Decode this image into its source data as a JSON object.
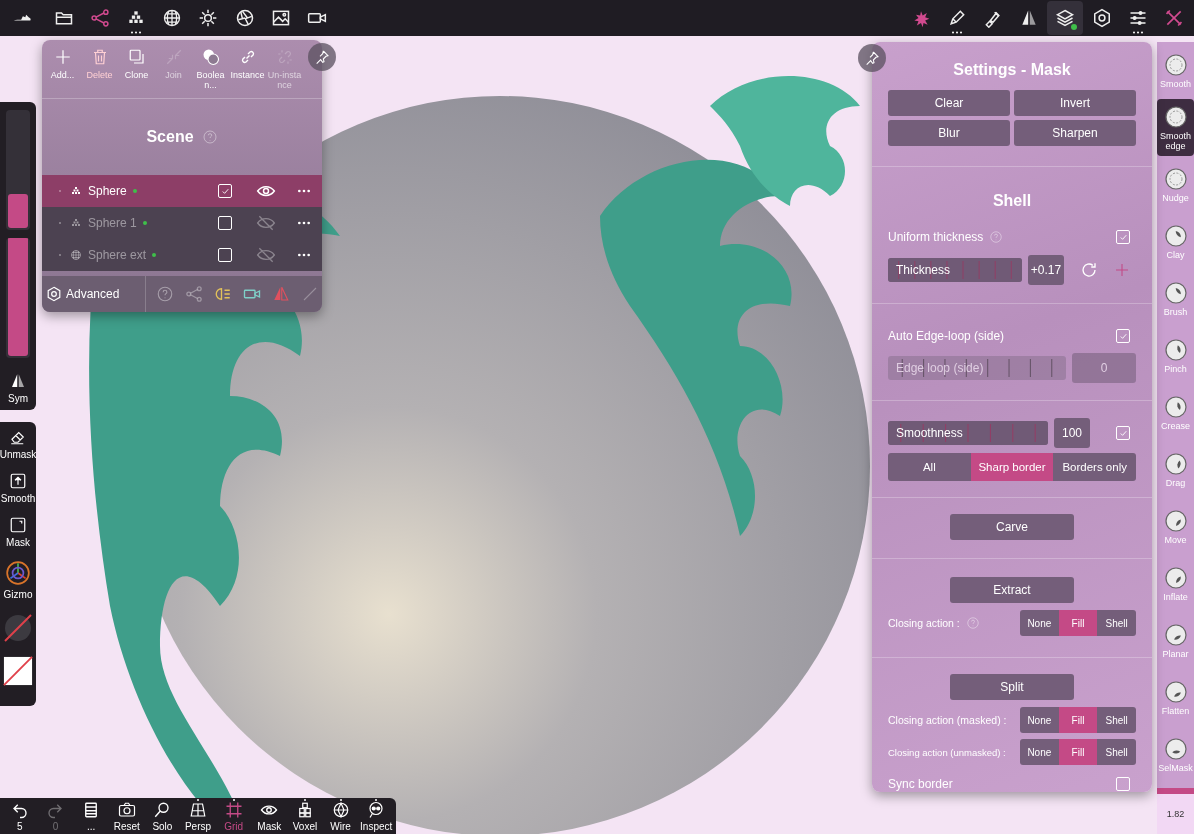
{
  "top_bar": {
    "left_tools": [
      {
        "selected": false,
        "has_menu": false
      },
      {
        "selected": false,
        "has_menu": false
      },
      {
        "selected": true,
        "has_menu": false
      },
      {
        "selected": false,
        "has_menu": true
      },
      {
        "selected": false,
        "has_menu": false
      },
      {
        "selected": false,
        "has_menu": false
      },
      {
        "selected": false,
        "has_menu": false
      },
      {
        "selected": false,
        "has_menu": false
      },
      {
        "selected": false,
        "has_menu": false
      }
    ],
    "right_tools": [
      {
        "selected": false,
        "has_menu": false
      },
      {
        "selected": false,
        "has_menu": true
      },
      {
        "selected": false,
        "has_menu": false
      },
      {
        "selected": false,
        "has_menu": false
      },
      {
        "selected": true,
        "has_menu": false
      },
      {
        "selected": false,
        "has_menu": false
      },
      {
        "selected": false,
        "has_menu": true
      },
      {
        "selected": false,
        "has_menu": false
      }
    ]
  },
  "scene_panel": {
    "actions": [
      {
        "label": "Add...",
        "kind": "normal",
        "disabled": false
      },
      {
        "label": "Delete",
        "kind": "danger",
        "disabled": false
      },
      {
        "label": "Clone",
        "kind": "normal",
        "disabled": false
      },
      {
        "label": "Join",
        "kind": "normal",
        "disabled": true
      },
      {
        "label": "Boolean...",
        "kind": "normal",
        "disabled": false
      },
      {
        "label": "Instance",
        "kind": "normal",
        "disabled": false
      },
      {
        "label": "Un-instance",
        "kind": "normal",
        "disabled": true
      }
    ],
    "title": "Scene",
    "objects": [
      {
        "name": "Sphere",
        "kind": "mesh",
        "selected": true,
        "checked": true,
        "visible": true
      },
      {
        "name": "Sphere 1",
        "kind": "mesh",
        "selected": false,
        "checked": false,
        "visible": false
      },
      {
        "name": "Sphere ext",
        "kind": "primitive",
        "selected": false,
        "checked": false,
        "visible": false
      }
    ],
    "footer": {
      "label": "Advanced"
    }
  },
  "left_toolbar": {
    "sliders": [
      {
        "level": 0.28
      },
      {
        "level": 1
      }
    ],
    "sym": {
      "label": "Sym"
    },
    "tools": [
      {
        "label": "Unmask"
      },
      {
        "label": "Smooth"
      },
      {
        "label": "Mask"
      },
      {
        "label": "Gizmo"
      }
    ]
  },
  "bottom_bar": {
    "items": [
      {
        "label": "5",
        "disabled": false,
        "selected": false,
        "has_menu": false
      },
      {
        "label": "0",
        "disabled": true,
        "selected": false,
        "has_menu": false
      },
      {
        "label": "...",
        "disabled": false,
        "selected": false,
        "has_menu": false
      },
      {
        "label": "Reset",
        "disabled": false,
        "selected": false,
        "has_menu": false
      },
      {
        "label": "Solo",
        "disabled": false,
        "selected": false,
        "has_menu": false
      },
      {
        "label": "Persp",
        "disabled": false,
        "selected": false,
        "has_menu": true
      },
      {
        "label": "Grid",
        "disabled": false,
        "selected": true,
        "has_menu": true
      },
      {
        "label": "Mask",
        "disabled": false,
        "selected": false,
        "has_menu": false
      },
      {
        "label": "Voxel",
        "disabled": false,
        "selected": false,
        "has_menu": true
      },
      {
        "label": "Wire",
        "disabled": false,
        "selected": false,
        "has_menu": true
      },
      {
        "label": "Inspect",
        "disabled": false,
        "selected": false,
        "has_menu": true
      }
    ]
  },
  "settings_panel": {
    "title": "Settings - Mask",
    "mask_actions": [
      "Clear",
      "Invert",
      "Blur",
      "Sharpen"
    ],
    "shell": {
      "title": "Shell",
      "uniform_thickness": {
        "label": "Uniform thickness",
        "checked": true
      },
      "thickness": {
        "label": "Thickness",
        "value": "+0.17",
        "level": 1
      },
      "auto_edge_loop": {
        "label": "Auto Edge-loop (side)",
        "checked": true
      },
      "edge_loop": {
        "label": "Edge loop (side)",
        "value": "0",
        "disabled": true
      },
      "smoothness": {
        "label": "Smoothness",
        "value": "100",
        "checked": true,
        "level": 1
      },
      "border_modes": [
        {
          "label": "All",
          "selected": false
        },
        {
          "label": "Sharp border",
          "selected": true
        },
        {
          "label": "Borders only",
          "selected": false
        }
      ]
    },
    "carve": {
      "label": "Carve"
    },
    "extract": {
      "label": "Extract",
      "closing_label": "Closing action :",
      "closing_options": [
        {
          "label": "None",
          "selected": false
        },
        {
          "label": "Fill",
          "selected": true
        },
        {
          "label": "Shell",
          "selected": false
        }
      ]
    },
    "split": {
      "label": "Split",
      "masked_label": "Closing action (masked) :",
      "masked_options": [
        {
          "label": "None",
          "selected": false
        },
        {
          "label": "Fill",
          "selected": true
        },
        {
          "label": "Shell",
          "selected": false
        }
      ],
      "unmasked_label": "Closing action (unmasked) :",
      "unmasked_options": [
        {
          "label": "None",
          "selected": false
        },
        {
          "label": "Fill",
          "selected": true
        },
        {
          "label": "Shell",
          "selected": false
        }
      ]
    },
    "sync_border": {
      "label": "Sync border",
      "checked": false
    }
  },
  "brushes": [
    {
      "label": "Smooth",
      "selected": false
    },
    {
      "label": "Smooth edge",
      "selected": true
    },
    {
      "label": "Nudge",
      "selected": false
    },
    {
      "label": "Clay",
      "selected": false
    },
    {
      "label": "Brush",
      "selected": false
    },
    {
      "label": "Pinch",
      "selected": false
    },
    {
      "label": "Crease",
      "selected": false
    },
    {
      "label": "Drag",
      "selected": false
    },
    {
      "label": "Move",
      "selected": false
    },
    {
      "label": "Inflate",
      "selected": false
    },
    {
      "label": "Planar",
      "selected": false
    },
    {
      "label": "Flatten",
      "selected": false
    },
    {
      "label": "SelMask",
      "selected": false
    }
  ],
  "brush_reading": "1.82"
}
